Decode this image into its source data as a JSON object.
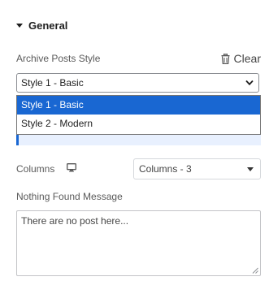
{
  "section": {
    "title": "General"
  },
  "archive_style": {
    "label": "Archive Posts Style",
    "clear_label": "Clear",
    "selected": "Style 1 - Basic",
    "options": [
      "Style 1 - Basic",
      "Style 2 - Modern"
    ]
  },
  "columns": {
    "label": "Columns",
    "value": "Columns - 3"
  },
  "nothing_found": {
    "label": "Nothing Found Message",
    "value": "There are no post here..."
  },
  "colors": {
    "highlight": "#1967d2",
    "text": "#555d66"
  }
}
